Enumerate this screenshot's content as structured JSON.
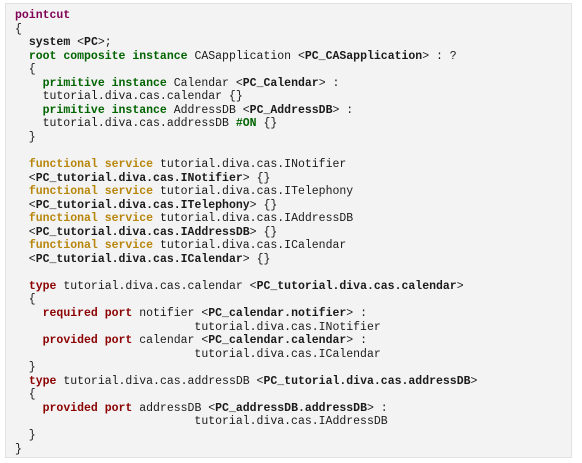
{
  "code_lines": [
    [
      {
        "t": "pointcut",
        "s": "kw-purple"
      }
    ],
    [
      {
        "t": "{",
        "s": "plain"
      }
    ],
    [
      {
        "t": "  ",
        "s": "plain"
      },
      {
        "t": "system",
        "s": "bold"
      },
      {
        "t": " <",
        "s": "plain"
      },
      {
        "t": "PC",
        "s": "bold"
      },
      {
        "t": ">;",
        "s": "plain"
      }
    ],
    [
      {
        "t": "  ",
        "s": "plain"
      },
      {
        "t": "root composite instance",
        "s": "kw-green"
      },
      {
        "t": " CASapplication <",
        "s": "plain"
      },
      {
        "t": "PC_CASapplication",
        "s": "bold"
      },
      {
        "t": "> : ?",
        "s": "plain"
      }
    ],
    [
      {
        "t": "  {",
        "s": "plain"
      }
    ],
    [
      {
        "t": "    ",
        "s": "plain"
      },
      {
        "t": "primitive instance",
        "s": "kw-green"
      },
      {
        "t": " Calendar <",
        "s": "plain"
      },
      {
        "t": "PC_Calendar",
        "s": "bold"
      },
      {
        "t": "> :",
        "s": "plain"
      }
    ],
    [
      {
        "t": "    tutorial.diva.cas.calendar {}",
        "s": "plain"
      }
    ],
    [
      {
        "t": "    ",
        "s": "plain"
      },
      {
        "t": "primitive instance",
        "s": "kw-green"
      },
      {
        "t": " AddressDB <",
        "s": "plain"
      },
      {
        "t": "PC_AddressDB",
        "s": "bold"
      },
      {
        "t": "> :",
        "s": "plain"
      }
    ],
    [
      {
        "t": "    tutorial.diva.cas.addressDB ",
        "s": "plain"
      },
      {
        "t": "#ON",
        "s": "tag-green"
      },
      {
        "t": " {}",
        "s": "plain"
      }
    ],
    [
      {
        "t": "  }",
        "s": "plain"
      }
    ],
    [
      {
        "t": "",
        "s": "plain"
      }
    ],
    [
      {
        "t": "  ",
        "s": "plain"
      },
      {
        "t": "functional service",
        "s": "kw-orange"
      },
      {
        "t": " tutorial.diva.cas.INotifier",
        "s": "plain"
      }
    ],
    [
      {
        "t": "  <",
        "s": "plain"
      },
      {
        "t": "PC_tutorial.diva.cas.INotifier",
        "s": "bold"
      },
      {
        "t": "> {}",
        "s": "plain"
      }
    ],
    [
      {
        "t": "  ",
        "s": "plain"
      },
      {
        "t": "functional service",
        "s": "kw-orange"
      },
      {
        "t": " tutorial.diva.cas.ITelephony",
        "s": "plain"
      }
    ],
    [
      {
        "t": "  <",
        "s": "plain"
      },
      {
        "t": "PC_tutorial.diva.cas.ITelephony",
        "s": "bold"
      },
      {
        "t": "> {}",
        "s": "plain"
      }
    ],
    [
      {
        "t": "  ",
        "s": "plain"
      },
      {
        "t": "functional service",
        "s": "kw-orange"
      },
      {
        "t": " tutorial.diva.cas.IAddressDB",
        "s": "plain"
      }
    ],
    [
      {
        "t": "  <",
        "s": "plain"
      },
      {
        "t": "PC_tutorial.diva.cas.IAddressDB",
        "s": "bold"
      },
      {
        "t": "> {}",
        "s": "plain"
      }
    ],
    [
      {
        "t": "  ",
        "s": "plain"
      },
      {
        "t": "functional service",
        "s": "kw-orange"
      },
      {
        "t": " tutorial.diva.cas.ICalendar",
        "s": "plain"
      }
    ],
    [
      {
        "t": "  <",
        "s": "plain"
      },
      {
        "t": "PC_tutorial.diva.cas.ICalendar",
        "s": "bold"
      },
      {
        "t": "> {}",
        "s": "plain"
      }
    ],
    [
      {
        "t": "",
        "s": "plain"
      }
    ],
    [
      {
        "t": "  ",
        "s": "plain"
      },
      {
        "t": "type",
        "s": "kw-red"
      },
      {
        "t": " tutorial.diva.cas.calendar <",
        "s": "plain"
      },
      {
        "t": "PC_tutorial.diva.cas.calendar",
        "s": "bold"
      },
      {
        "t": ">",
        "s": "plain"
      }
    ],
    [
      {
        "t": "  {",
        "s": "plain"
      }
    ],
    [
      {
        "t": "    ",
        "s": "plain"
      },
      {
        "t": "required port",
        "s": "kw-red"
      },
      {
        "t": " notifier <",
        "s": "plain"
      },
      {
        "t": "PC_calendar.notifier",
        "s": "bold"
      },
      {
        "t": "> :",
        "s": "plain"
      }
    ],
    [
      {
        "t": "                          tutorial.diva.cas.INotifier",
        "s": "plain"
      }
    ],
    [
      {
        "t": "    ",
        "s": "plain"
      },
      {
        "t": "provided port",
        "s": "kw-red"
      },
      {
        "t": " calendar <",
        "s": "plain"
      },
      {
        "t": "PC_calendar.calendar",
        "s": "bold"
      },
      {
        "t": "> :",
        "s": "plain"
      }
    ],
    [
      {
        "t": "                          tutorial.diva.cas.ICalendar",
        "s": "plain"
      }
    ],
    [
      {
        "t": "  }",
        "s": "plain"
      }
    ],
    [
      {
        "t": "  ",
        "s": "plain"
      },
      {
        "t": "type",
        "s": "kw-red"
      },
      {
        "t": " tutorial.diva.cas.addressDB <",
        "s": "plain"
      },
      {
        "t": "PC_tutorial.diva.cas.addressDB",
        "s": "bold"
      },
      {
        "t": ">",
        "s": "plain"
      }
    ],
    [
      {
        "t": "  {",
        "s": "plain"
      }
    ],
    [
      {
        "t": "    ",
        "s": "plain"
      },
      {
        "t": "provided port",
        "s": "kw-red"
      },
      {
        "t": " addressDB <",
        "s": "plain"
      },
      {
        "t": "PC_addressDB.addressDB",
        "s": "bold"
      },
      {
        "t": "> :",
        "s": "plain"
      }
    ],
    [
      {
        "t": "                          tutorial.diva.cas.IAddressDB",
        "s": "plain"
      }
    ],
    [
      {
        "t": "  }",
        "s": "plain"
      }
    ],
    [
      {
        "t": "}",
        "s": "plain"
      }
    ]
  ],
  "colors": {
    "background": "#f3f3f3",
    "keyword_purple": "#7f0055",
    "keyword_green": "#006400",
    "keyword_orange": "#b8860b",
    "keyword_red": "#8b0000"
  }
}
